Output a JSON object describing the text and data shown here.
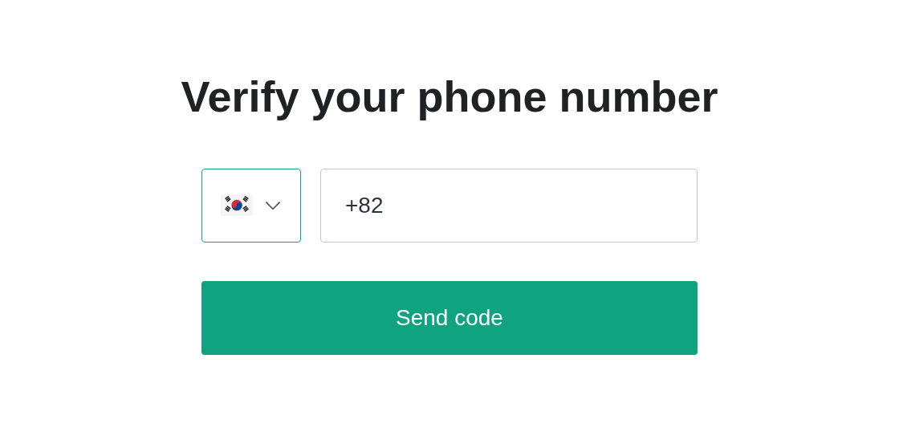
{
  "title": "Verify your phone number",
  "country_select": {
    "focused": true
  },
  "phone_field": {
    "value": "+82"
  },
  "submit_button": {
    "label": "Send code"
  }
}
